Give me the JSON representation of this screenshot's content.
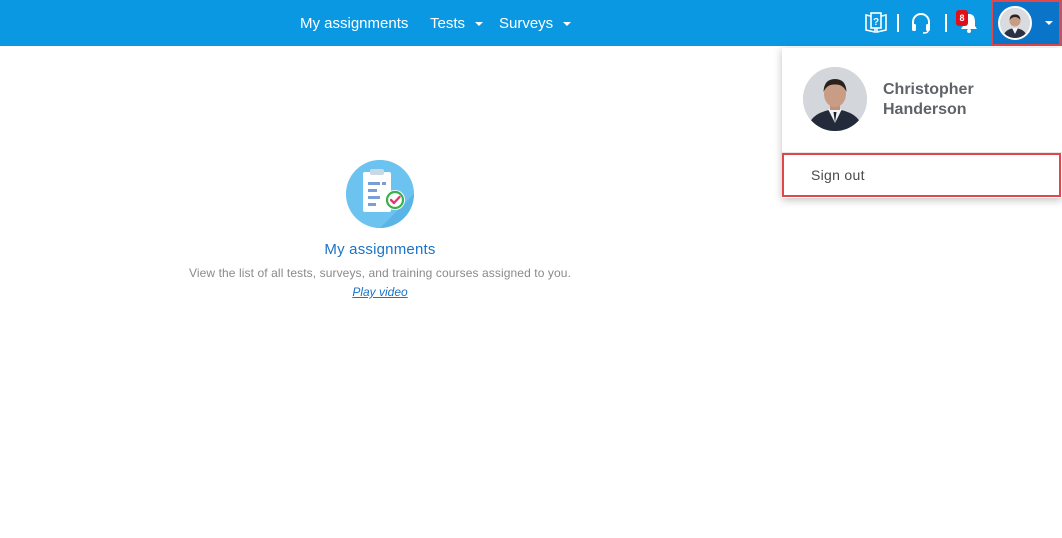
{
  "header": {
    "nav": [
      {
        "label": "My assignments"
      },
      {
        "label": "Tests"
      },
      {
        "label": "Surveys"
      }
    ],
    "notification_count": "8",
    "icons": [
      "help-book-icon",
      "headset-icon",
      "bell-icon",
      "avatar",
      "chevron-down-icon"
    ]
  },
  "user_menu": {
    "name": "Christopher Handerson",
    "sign_out_label": "Sign out"
  },
  "main": {
    "tile": {
      "icon": "clipboard-check-icon",
      "title": "My assignments",
      "description": "View the list of all tests, surveys, and training courses assigned to you.",
      "link": "Play video"
    }
  },
  "colors": {
    "header_bg": "#0b98e3",
    "avatar_button_bg": "#0a74c9",
    "highlight_border": "#e0474c",
    "link_blue": "#1a73c8",
    "badge_red": "#e0101a"
  }
}
